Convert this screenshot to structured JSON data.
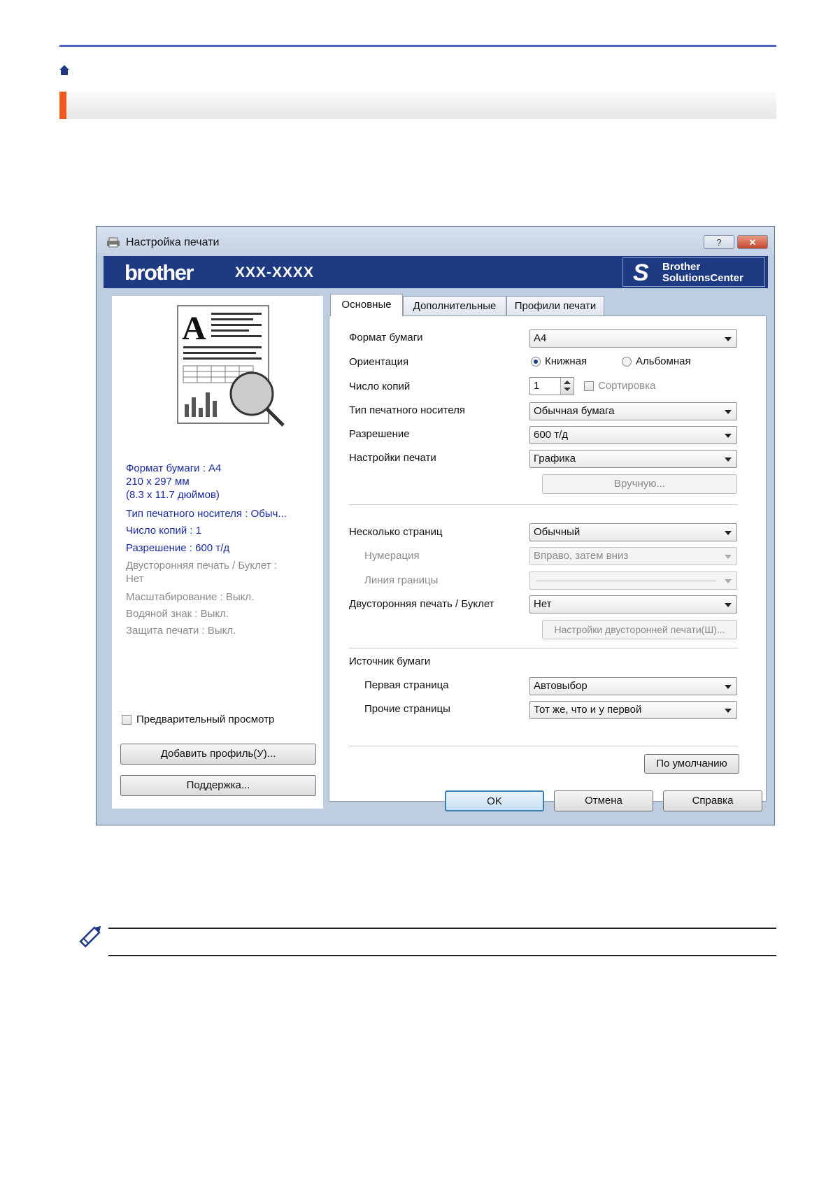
{
  "dialog": {
    "title": "Настройка печати",
    "help_label": "?",
    "close_label": "✕",
    "brand": "brother",
    "model": "XXX-XXXX",
    "solutions_center": [
      "Brother",
      "SolutionsCenter"
    ],
    "summary": {
      "paper_size": "Формат бумаги : A4",
      "paper_dims_mm": "210 x 297 мм",
      "paper_dims_in": "(8.3 x 11.7 дюймов)",
      "media_type": "Тип печатного носителя : Обыч...",
      "copies": "Число копий : 1",
      "resolution": "Разрешение : 600 т/д",
      "duplex_line1": "Двусторонняя печать / Буклет :",
      "duplex_line2": "Нет",
      "scaling": "Масштабирование : Выкл.",
      "watermark": "Водяной знак : Выкл.",
      "secure_print": "Защита печати : Выкл."
    },
    "preview_label": "Предварительный просмотр",
    "add_profile_label": "Добавить профиль(У)...",
    "support_label": "Поддержка...",
    "tabs": [
      "Основные",
      "Дополнительные",
      "Профили печати"
    ],
    "fields": {
      "paper_size_label": "Формат бумаги",
      "paper_size_value": "A4",
      "orientation_label": "Ориентация",
      "portrait_label": "Книжная",
      "landscape_label": "Альбомная",
      "copies_label": "Число копий",
      "copies_value": "1",
      "collate_label": "Сортировка",
      "media_label": "Тип печатного носителя",
      "media_value": "Обычная бумага",
      "resolution_label": "Разрешение",
      "resolution_value": "600 т/д",
      "print_settings_label": "Настройки печати",
      "print_settings_value": "Графика",
      "manual_label": "Вручную...",
      "multi_page_label": "Несколько страниц",
      "multi_page_value": "Обычный",
      "page_order_label": "Нумерация",
      "page_order_value": "Вправо, затем вниз",
      "border_line_label": "Линия границы",
      "duplex_label": "Двусторонняя печать / Буклет",
      "duplex_value": "Нет",
      "duplex_settings_label": "Настройки двусторонней печати(Ш)...",
      "paper_source_label": "Источник бумаги",
      "first_page_label": "Первая страница",
      "first_page_value": "Автовыбор",
      "other_pages_label": "Прочие страницы",
      "other_pages_value": "Тот же, что и у первой",
      "default_label": "По умолчанию"
    },
    "ok_label": "OK",
    "cancel_label": "Отмена",
    "help_button_label": "Справка"
  }
}
